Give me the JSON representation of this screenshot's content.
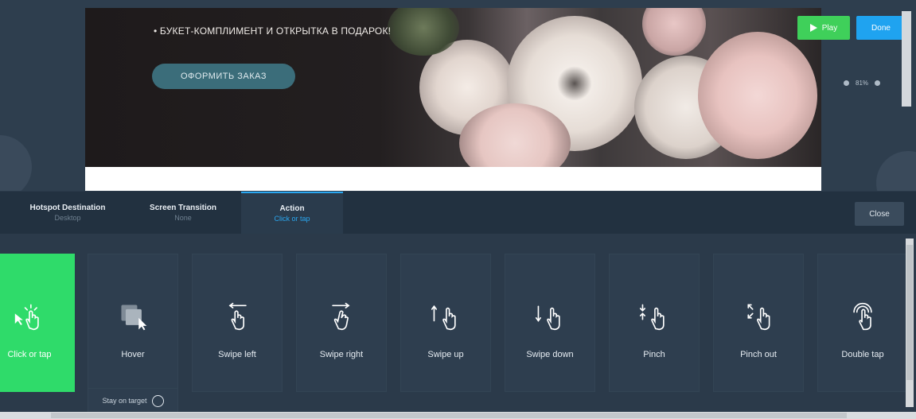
{
  "preview": {
    "promo_text": "• БУКЕТ-КОМПЛИМЕНТ И ОТКРЫТКА В ПОДАРОК!",
    "order_button": "ОФОРМИТЬ ЗАКАЗ"
  },
  "toolbar": {
    "play_label": "Play",
    "done_label": "Done",
    "zoom_value": "81%"
  },
  "tabs": [
    {
      "title": "Hotspot Destination",
      "subtitle": "Desktop"
    },
    {
      "title": "Screen Transition",
      "subtitle": "None"
    },
    {
      "title": "Action",
      "subtitle": "Click or tap"
    }
  ],
  "close_label": "Close",
  "actions": [
    {
      "label": "Click or tap",
      "icon": "click-tap-icon",
      "selected": true
    },
    {
      "label": "Hover",
      "icon": "hover-icon"
    },
    {
      "label": "Swipe left",
      "icon": "swipe-left-icon"
    },
    {
      "label": "Swipe right",
      "icon": "swipe-right-icon"
    },
    {
      "label": "Swipe up",
      "icon": "swipe-up-icon"
    },
    {
      "label": "Swipe down",
      "icon": "swipe-down-icon"
    },
    {
      "label": "Pinch",
      "icon": "pinch-icon"
    },
    {
      "label": "Pinch out",
      "icon": "pinch-out-icon"
    },
    {
      "label": "Double tap",
      "icon": "double-tap-icon"
    }
  ],
  "stay_on_target": "Stay on target",
  "colors": {
    "selected_green": "#2fdb6a",
    "play_green": "#3fd05a",
    "done_blue": "#1fa3f0",
    "active_tab_blue": "#2aa7f0"
  }
}
